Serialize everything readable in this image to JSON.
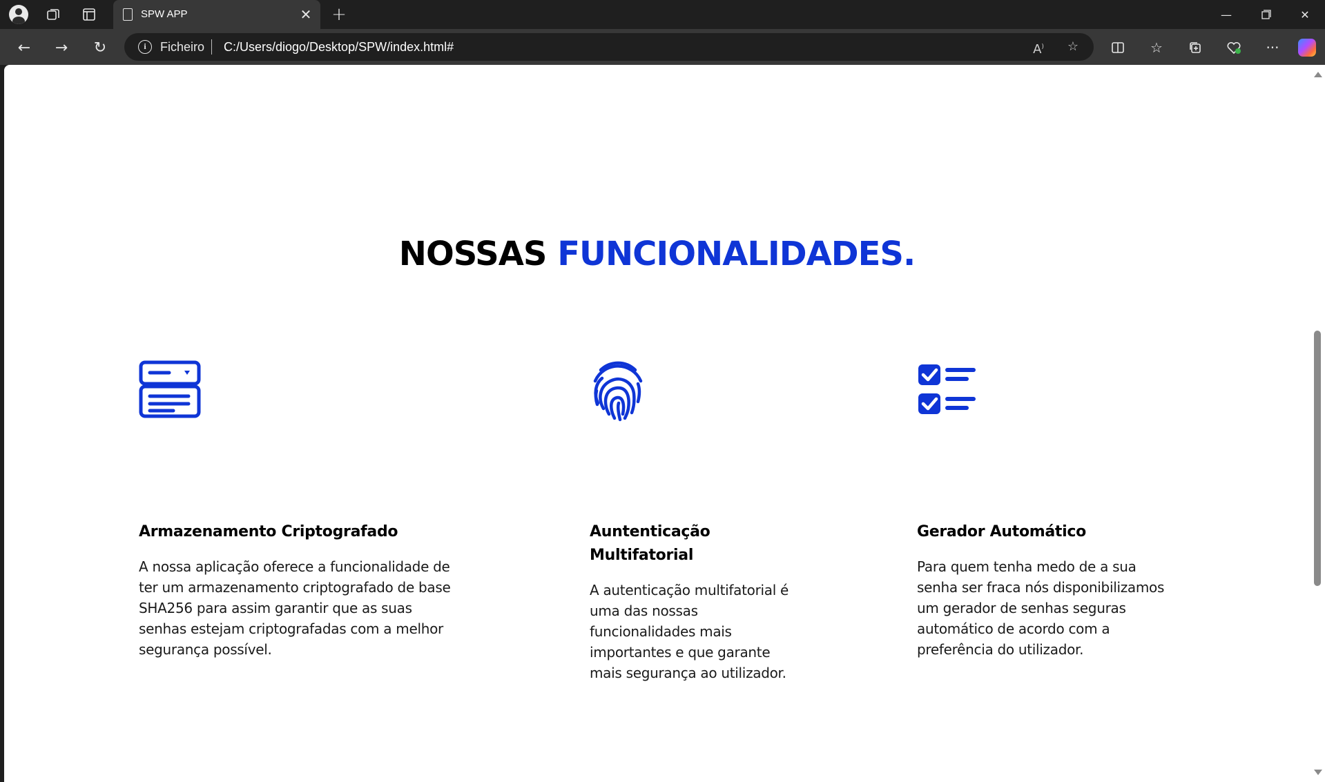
{
  "browser": {
    "tab_title": "SPW APP",
    "address_scheme_label": "Ficheiro",
    "url": "C:/Users/diogo/Desktop/SPW/index.html#",
    "icons": [
      "profile-icon",
      "workspaces-icon",
      "vertical-tabs-icon",
      "document-icon",
      "close-icon",
      "new-tab-icon",
      "minimize-icon",
      "restore-icon",
      "window-close-icon",
      "back-icon",
      "forward-icon",
      "refresh-icon",
      "info-icon",
      "read-aloud-icon",
      "favorite-star-icon",
      "split-screen-icon",
      "favorites-icon",
      "collections-icon",
      "browser-essentials-icon",
      "more-icon",
      "copilot-icon"
    ]
  },
  "page": {
    "heading_part1": "NOSSAS",
    "heading_part2": "FUNCIONALIDADES.",
    "accent_color": "#0f35d6",
    "features": [
      {
        "icon": "server-storage-icon",
        "title": "Armazenamento Criptografado",
        "text_lines": [
          "A nossa aplicação oferece a funcionalidade de",
          "ter um armazenamento criptografado de base",
          "SHA256 para assim garantir que as suas",
          "senhas estejam criptografadas com a melhor",
          "segurança possível."
        ]
      },
      {
        "icon": "fingerprint-icon",
        "title_lines": [
          "Auntenticação",
          "Multifatorial"
        ],
        "text_lines": [
          "A autenticação multifatorial é",
          "uma das nossas",
          "funcionalidades mais",
          "importantes e que garante",
          "mais segurança ao utilizador."
        ]
      },
      {
        "icon": "checklist-icon",
        "title": "Gerador Automático",
        "text_lines": [
          "Para quem tenha medo de a sua",
          "senha ser fraca nós disponibilizamos",
          "um gerador de senhas seguras",
          "automático de acordo com a",
          "preferência do utilizador."
        ]
      }
    ]
  }
}
